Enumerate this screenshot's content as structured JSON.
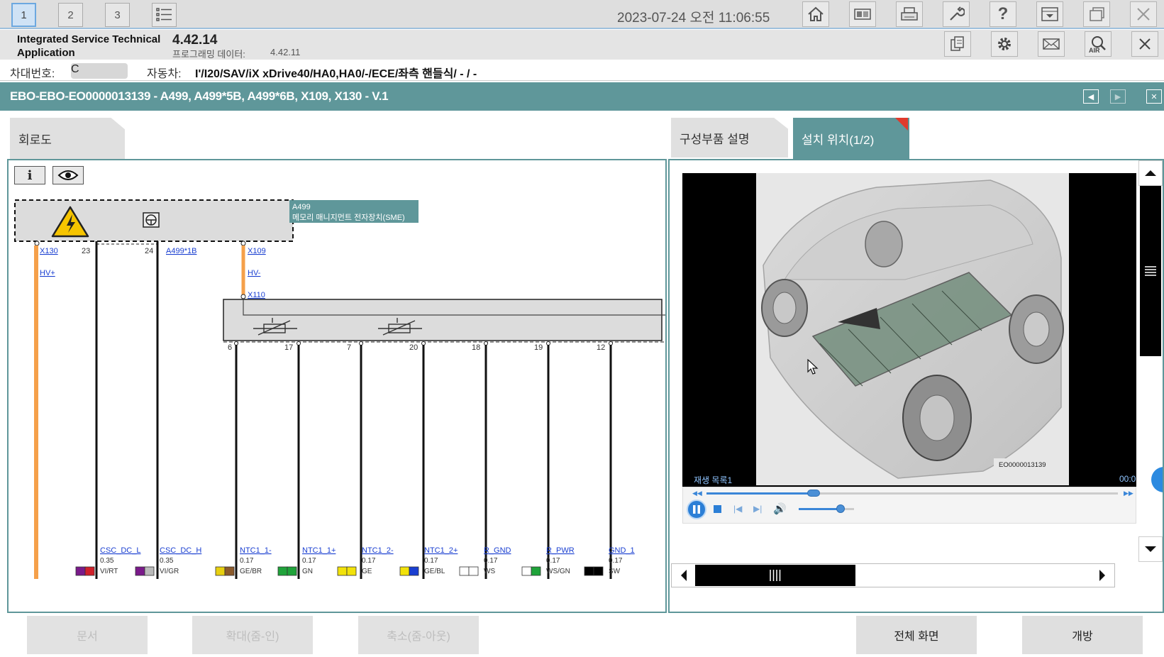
{
  "window": {
    "tabs": [
      "1",
      "2",
      "3"
    ],
    "datetime": "2023-07-24 오전 11:06:55",
    "toolbar_icons": [
      "home-icon",
      "id-card-icon",
      "printer-icon",
      "wrench-icon",
      "help-icon",
      "download-tray-icon",
      "window-icon",
      "close-icon"
    ],
    "secondary_icons": [
      "documents-icon",
      "settings-gear-icon",
      "mail-icon",
      "air-search-icon",
      "close-icon"
    ]
  },
  "app": {
    "name": "Integrated Service Technical Application",
    "version": "4.42.14",
    "programming_data_label": "프로그래밍 데이터:",
    "programming_data_value": "4.42.11"
  },
  "vehicle": {
    "vin_label": "차대번호:",
    "vin_value": "C",
    "car_label": "자동차:",
    "car_value": "I'/I20/SAV/iX xDrive40/HA0,HA0/-/ECE/좌측 핸들식/ - / -"
  },
  "document": {
    "title": "EBO-EBO-EO0000013139 - A499, A499*5B, A499*6B, X109, X130 - V.1"
  },
  "tabs": {
    "circuit": "회로도",
    "parts": "구성부품 설명",
    "install": "설치 위치(1/2)"
  },
  "diagram": {
    "buttons": [
      "i",
      "eye"
    ],
    "module_id": "A499",
    "module_name": "메모리 매니지먼트 전자장치(SME)",
    "top_connectors": [
      {
        "pin": "",
        "label": "X130",
        "signal": "HV+"
      },
      {
        "pin": "23",
        "label": "",
        "signal": ""
      },
      {
        "pin": "24",
        "label": "A499*1B",
        "signal": ""
      },
      {
        "pin": "",
        "label": "X109",
        "signal": "HV-"
      }
    ],
    "x110_label": "X110",
    "bottom_pins": [
      "6",
      "17",
      "7",
      "20",
      "18",
      "19",
      "12"
    ],
    "wires": [
      {
        "name": "CSC_DC_L",
        "size": "0.35",
        "color_code": "VI/RT"
      },
      {
        "name": "CSC_DC_H",
        "size": "0.35",
        "color_code": "VI/GR"
      },
      {
        "name": "NTC1_1-",
        "size": "0.17",
        "color_code": "GE/BR"
      },
      {
        "name": "NTC1_1+",
        "size": "0.17",
        "color_code": "GN"
      },
      {
        "name": "NTC1_2-",
        "size": "0.17",
        "color_code": "GE"
      },
      {
        "name": "NTC1_2+",
        "size": "0.17",
        "color_code": "GE/BL"
      },
      {
        "name": "R_GND",
        "size": "0.17",
        "color_code": "WS"
      },
      {
        "name": "R_PWR",
        "size": "0.17",
        "color_code": "WS/GN"
      },
      {
        "name": "GND_1",
        "size": "0.17",
        "color_code": "SW"
      }
    ]
  },
  "media": {
    "image_code": "EO0000013139",
    "playlist_label": "재생 목록1",
    "time": "00:0",
    "progress": 0.26,
    "volume": 0.75
  },
  "bottom_buttons": {
    "document": "문서",
    "zoom_in": "확대(줌-인)",
    "zoom_out": "축소(줌-아웃)",
    "fullscreen": "전체 화면",
    "open": "개방"
  }
}
